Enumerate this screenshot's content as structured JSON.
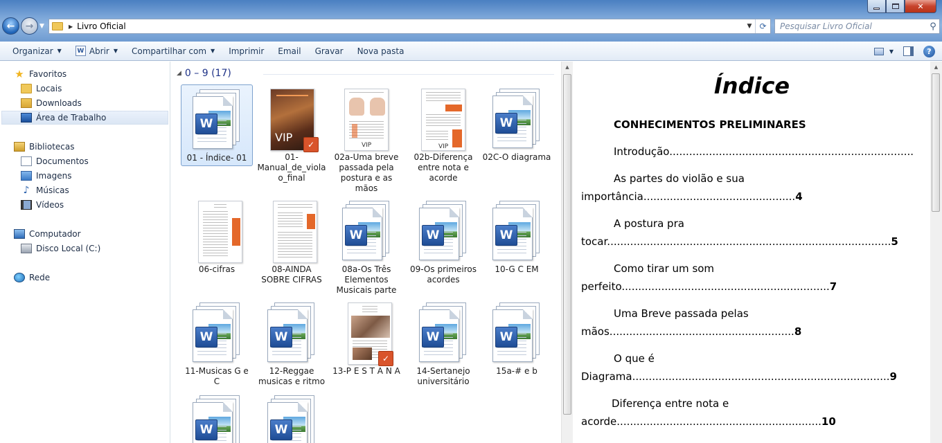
{
  "address": {
    "breadcrumb": "Livro Oficial",
    "search_placeholder": "Pesquisar Livro Oficial"
  },
  "toolbar": {
    "organize": "Organizar",
    "open": "Abrir",
    "share": "Compartilhar com",
    "print": "Imprimir",
    "email": "Email",
    "burn": "Gravar",
    "new_folder": "Nova pasta"
  },
  "nav": {
    "favorites": "Favoritos",
    "locais": "Locais",
    "downloads": "Downloads",
    "desktop": "Área de Trabalho",
    "libraries": "Bibliotecas",
    "documents": "Documentos",
    "images": "Imagens",
    "music": "Músicas",
    "videos": "Vídeos",
    "computer": "Computador",
    "disk": "Disco Local (C:)",
    "network": "Rede"
  },
  "group": {
    "label": "0 – 9 (17)"
  },
  "files": [
    {
      "name": "01 - Índice- 01",
      "type": "word"
    },
    {
      "name": "01-Manual_de_violao_final",
      "type": "pdf-cover"
    },
    {
      "name": "02a-Uma breve passada pela postura e as mãos",
      "type": "pdf-hands"
    },
    {
      "name": "02b-Diferença entre nota e acorde",
      "type": "pdf-doc"
    },
    {
      "name": "02C-O diagrama",
      "type": "word"
    },
    {
      "name": "06-cifras",
      "type": "doc-thumb"
    },
    {
      "name": "08-AINDA SOBRE CIFRAS",
      "type": "doc-thumb"
    },
    {
      "name": "08a-Os Três Elementos Musicais parte",
      "type": "word"
    },
    {
      "name": "09-Os primeiros acordes",
      "type": "word"
    },
    {
      "name": "10-G C EM",
      "type": "word"
    },
    {
      "name": "11-Musicas G e C",
      "type": "word"
    },
    {
      "name": "12-Reggae musicas e ritmo",
      "type": "word"
    },
    {
      "name": "13-P E S T A N A",
      "type": "pdf-pestana"
    },
    {
      "name": "14-Sertanejo universitário",
      "type": "word"
    },
    {
      "name": "15a-# e b",
      "type": "word"
    }
  ],
  "thumb_text": {
    "vip": "VIP",
    "word_badge": "W",
    "pdf_badge": "✓"
  },
  "preview": {
    "title": "Índice",
    "heading": "CONHECIMENTOS PRELIMINARES",
    "intro": "Introdução..........................................................................",
    "l1a": "As partes do violão e sua",
    "l1b": "importância",
    "l1dots": "..............................................",
    "l1num": "4",
    "l2a": "A postura pra",
    "l2b": "tocar",
    "l2dots": "......................................................................................",
    "l2num": "5",
    "l3a": "Como tirar um som",
    "l3b": "perfeito",
    "l3dots": "...............................................................",
    "l3num": "7",
    "l4a": "Uma Breve passada pelas",
    "l4b": "mãos",
    "l4dots": "........................................................",
    "l4num": "8",
    "l5a": "O que é",
    "l5b": "Diagrama",
    "l5dots": "..............................................................................",
    "l5num": "9",
    "l6a": "Diferença entre nota e",
    "l6b": "acorde",
    "l6dots": "..............................................................",
    "l6num": "10"
  }
}
